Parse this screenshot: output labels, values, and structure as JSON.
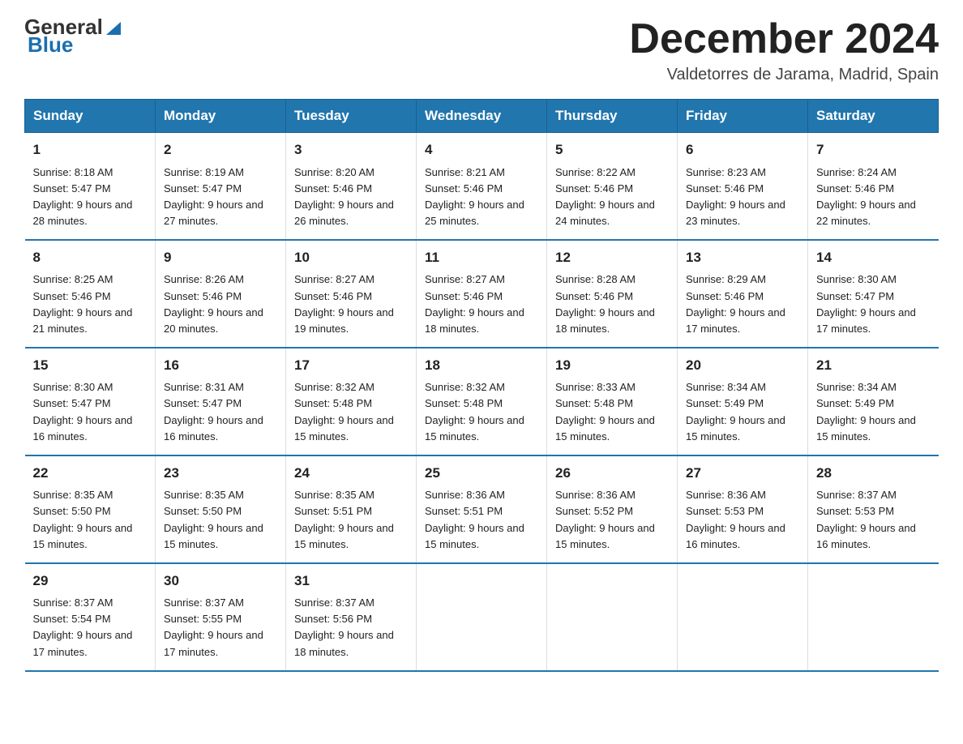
{
  "header": {
    "logo_general": "General",
    "logo_blue": "Blue",
    "month_title": "December 2024",
    "location": "Valdetorres de Jarama, Madrid, Spain"
  },
  "days_of_week": [
    "Sunday",
    "Monday",
    "Tuesday",
    "Wednesday",
    "Thursday",
    "Friday",
    "Saturday"
  ],
  "weeks": [
    [
      {
        "day": "1",
        "sunrise": "Sunrise: 8:18 AM",
        "sunset": "Sunset: 5:47 PM",
        "daylight": "Daylight: 9 hours and 28 minutes."
      },
      {
        "day": "2",
        "sunrise": "Sunrise: 8:19 AM",
        "sunset": "Sunset: 5:47 PM",
        "daylight": "Daylight: 9 hours and 27 minutes."
      },
      {
        "day": "3",
        "sunrise": "Sunrise: 8:20 AM",
        "sunset": "Sunset: 5:46 PM",
        "daylight": "Daylight: 9 hours and 26 minutes."
      },
      {
        "day": "4",
        "sunrise": "Sunrise: 8:21 AM",
        "sunset": "Sunset: 5:46 PM",
        "daylight": "Daylight: 9 hours and 25 minutes."
      },
      {
        "day": "5",
        "sunrise": "Sunrise: 8:22 AM",
        "sunset": "Sunset: 5:46 PM",
        "daylight": "Daylight: 9 hours and 24 minutes."
      },
      {
        "day": "6",
        "sunrise": "Sunrise: 8:23 AM",
        "sunset": "Sunset: 5:46 PM",
        "daylight": "Daylight: 9 hours and 23 minutes."
      },
      {
        "day": "7",
        "sunrise": "Sunrise: 8:24 AM",
        "sunset": "Sunset: 5:46 PM",
        "daylight": "Daylight: 9 hours and 22 minutes."
      }
    ],
    [
      {
        "day": "8",
        "sunrise": "Sunrise: 8:25 AM",
        "sunset": "Sunset: 5:46 PM",
        "daylight": "Daylight: 9 hours and 21 minutes."
      },
      {
        "day": "9",
        "sunrise": "Sunrise: 8:26 AM",
        "sunset": "Sunset: 5:46 PM",
        "daylight": "Daylight: 9 hours and 20 minutes."
      },
      {
        "day": "10",
        "sunrise": "Sunrise: 8:27 AM",
        "sunset": "Sunset: 5:46 PM",
        "daylight": "Daylight: 9 hours and 19 minutes."
      },
      {
        "day": "11",
        "sunrise": "Sunrise: 8:27 AM",
        "sunset": "Sunset: 5:46 PM",
        "daylight": "Daylight: 9 hours and 18 minutes."
      },
      {
        "day": "12",
        "sunrise": "Sunrise: 8:28 AM",
        "sunset": "Sunset: 5:46 PM",
        "daylight": "Daylight: 9 hours and 18 minutes."
      },
      {
        "day": "13",
        "sunrise": "Sunrise: 8:29 AM",
        "sunset": "Sunset: 5:46 PM",
        "daylight": "Daylight: 9 hours and 17 minutes."
      },
      {
        "day": "14",
        "sunrise": "Sunrise: 8:30 AM",
        "sunset": "Sunset: 5:47 PM",
        "daylight": "Daylight: 9 hours and 17 minutes."
      }
    ],
    [
      {
        "day": "15",
        "sunrise": "Sunrise: 8:30 AM",
        "sunset": "Sunset: 5:47 PM",
        "daylight": "Daylight: 9 hours and 16 minutes."
      },
      {
        "day": "16",
        "sunrise": "Sunrise: 8:31 AM",
        "sunset": "Sunset: 5:47 PM",
        "daylight": "Daylight: 9 hours and 16 minutes."
      },
      {
        "day": "17",
        "sunrise": "Sunrise: 8:32 AM",
        "sunset": "Sunset: 5:48 PM",
        "daylight": "Daylight: 9 hours and 15 minutes."
      },
      {
        "day": "18",
        "sunrise": "Sunrise: 8:32 AM",
        "sunset": "Sunset: 5:48 PM",
        "daylight": "Daylight: 9 hours and 15 minutes."
      },
      {
        "day": "19",
        "sunrise": "Sunrise: 8:33 AM",
        "sunset": "Sunset: 5:48 PM",
        "daylight": "Daylight: 9 hours and 15 minutes."
      },
      {
        "day": "20",
        "sunrise": "Sunrise: 8:34 AM",
        "sunset": "Sunset: 5:49 PM",
        "daylight": "Daylight: 9 hours and 15 minutes."
      },
      {
        "day": "21",
        "sunrise": "Sunrise: 8:34 AM",
        "sunset": "Sunset: 5:49 PM",
        "daylight": "Daylight: 9 hours and 15 minutes."
      }
    ],
    [
      {
        "day": "22",
        "sunrise": "Sunrise: 8:35 AM",
        "sunset": "Sunset: 5:50 PM",
        "daylight": "Daylight: 9 hours and 15 minutes."
      },
      {
        "day": "23",
        "sunrise": "Sunrise: 8:35 AM",
        "sunset": "Sunset: 5:50 PM",
        "daylight": "Daylight: 9 hours and 15 minutes."
      },
      {
        "day": "24",
        "sunrise": "Sunrise: 8:35 AM",
        "sunset": "Sunset: 5:51 PM",
        "daylight": "Daylight: 9 hours and 15 minutes."
      },
      {
        "day": "25",
        "sunrise": "Sunrise: 8:36 AM",
        "sunset": "Sunset: 5:51 PM",
        "daylight": "Daylight: 9 hours and 15 minutes."
      },
      {
        "day": "26",
        "sunrise": "Sunrise: 8:36 AM",
        "sunset": "Sunset: 5:52 PM",
        "daylight": "Daylight: 9 hours and 15 minutes."
      },
      {
        "day": "27",
        "sunrise": "Sunrise: 8:36 AM",
        "sunset": "Sunset: 5:53 PM",
        "daylight": "Daylight: 9 hours and 16 minutes."
      },
      {
        "day": "28",
        "sunrise": "Sunrise: 8:37 AM",
        "sunset": "Sunset: 5:53 PM",
        "daylight": "Daylight: 9 hours and 16 minutes."
      }
    ],
    [
      {
        "day": "29",
        "sunrise": "Sunrise: 8:37 AM",
        "sunset": "Sunset: 5:54 PM",
        "daylight": "Daylight: 9 hours and 17 minutes."
      },
      {
        "day": "30",
        "sunrise": "Sunrise: 8:37 AM",
        "sunset": "Sunset: 5:55 PM",
        "daylight": "Daylight: 9 hours and 17 minutes."
      },
      {
        "day": "31",
        "sunrise": "Sunrise: 8:37 AM",
        "sunset": "Sunset: 5:56 PM",
        "daylight": "Daylight: 9 hours and 18 minutes."
      },
      null,
      null,
      null,
      null
    ]
  ]
}
